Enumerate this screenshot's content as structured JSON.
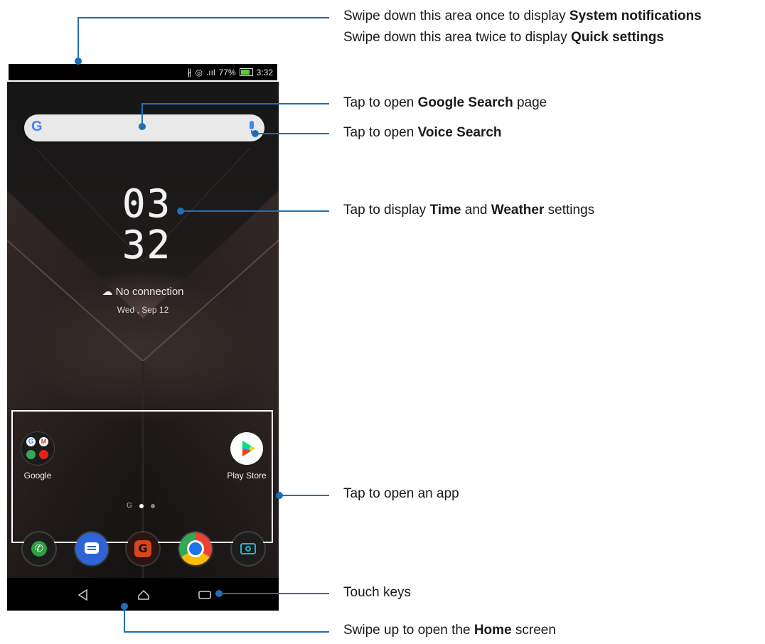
{
  "status_bar": {
    "bluetooth_icon": "bluetooth-icon",
    "signal_text": ".ııl",
    "battery_percent": "77%",
    "battery_fill": 0.77,
    "time": "3:32"
  },
  "search_bar": {
    "logo": "G",
    "mic_icon": "mic-icon"
  },
  "clock": {
    "hour": "03",
    "minute": "32"
  },
  "weather": {
    "icon": "cloud-icon",
    "text": "No connection"
  },
  "date": "Wed , Sep 12",
  "apps": [
    {
      "label": "Google",
      "icon": "google-folder-icon"
    },
    {
      "label": "Play Store",
      "icon": "play-store-icon"
    }
  ],
  "page_indicator": {
    "google_mark": "G",
    "current": 1,
    "total": 2
  },
  "dock": [
    {
      "name": "phone-app",
      "icon": "phone-icon",
      "color": "#2f9e44"
    },
    {
      "name": "messages-app",
      "icon": "messages-icon",
      "color": "#2e64d6"
    },
    {
      "name": "game-center-app",
      "icon": "game-center-icon",
      "color": "#d4461e"
    },
    {
      "name": "chrome-app",
      "icon": "chrome-icon",
      "color": "#1a73e8"
    },
    {
      "name": "camera-app",
      "icon": "camera-icon",
      "color": "#2bb3c9"
    }
  ],
  "nav_keys": [
    "back-icon",
    "home-icon",
    "recents-icon"
  ],
  "callouts": {
    "status_line1_pre": "Swipe down this area once to display ",
    "status_line1_bold": "System notifications",
    "status_line2_pre": "Swipe down this area twice to display ",
    "status_line2_bold": "Quick settings",
    "search_pre": "Tap to open ",
    "search_bold": "Google Search",
    "search_post": " page",
    "voice_pre": "Tap to open ",
    "voice_bold": "Voice Search",
    "time_pre": "Tap to display ",
    "time_bold1": "Time",
    "time_mid": " and ",
    "time_bold2": "Weather",
    "time_post": " settings",
    "apps": "Tap to open an app",
    "touch_keys": "Touch keys",
    "home_pre": "Swipe up to open the ",
    "home_bold": "Home",
    "home_post": " screen"
  }
}
